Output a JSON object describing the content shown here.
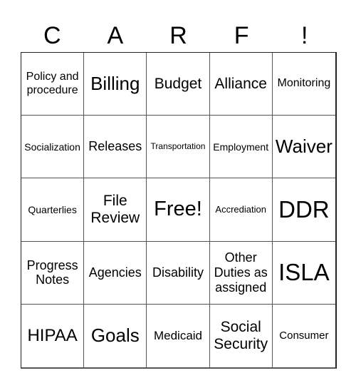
{
  "header": {
    "letters": [
      "C",
      "A",
      "R",
      "F",
      "!"
    ]
  },
  "cells": [
    [
      "Policy and procedure",
      "Billing",
      "Budget",
      "Alliance",
      "Monitoring"
    ],
    [
      "Socialization",
      "Releases",
      "Transportation",
      "Employment",
      "Waiver"
    ],
    [
      "Quarterlies",
      "File Review",
      "Free!",
      "Accrediation",
      "DDR"
    ],
    [
      "Progress Notes",
      "Agencies",
      "Disability",
      "Other Duties as assigned",
      "ISLA"
    ],
    [
      "HIPAA",
      "Goals",
      "Medicaid",
      "Social Security",
      "Consumer"
    ]
  ],
  "colors": {
    "text": "#000000",
    "background": "#ffffff",
    "grid_line": "#555555"
  }
}
